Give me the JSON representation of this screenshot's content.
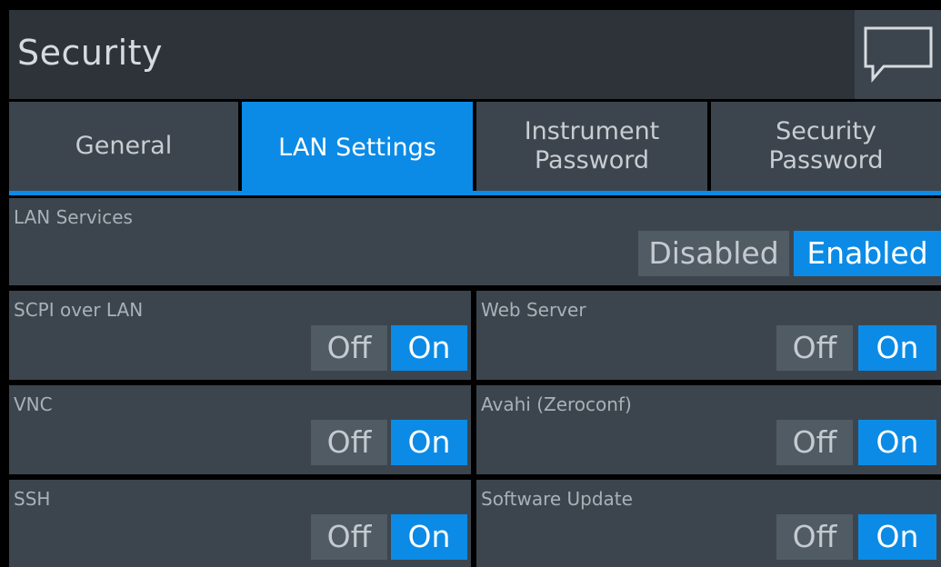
{
  "header": {
    "title": "Security",
    "chat_icon": "speech-bubble-icon"
  },
  "tabs": [
    {
      "label": "General",
      "active": false
    },
    {
      "label": "LAN Settings",
      "active": true
    },
    {
      "label": "Instrument\nPassword",
      "active": false
    },
    {
      "label": "Security\nPassword",
      "active": false
    }
  ],
  "lan_services": {
    "label": "LAN Services",
    "disabled_label": "Disabled",
    "enabled_label": "Enabled",
    "value": "Enabled"
  },
  "settings": {
    "scpi_over_lan": {
      "label": "SCPI over LAN",
      "off": "Off",
      "on": "On",
      "value": "On"
    },
    "web_server": {
      "label": "Web Server",
      "off": "Off",
      "on": "On",
      "value": "On"
    },
    "vnc": {
      "label": "VNC",
      "off": "Off",
      "on": "On",
      "value": "On"
    },
    "avahi": {
      "label": "Avahi (Zeroconf)",
      "off": "Off",
      "on": "On",
      "value": "On"
    },
    "ssh": {
      "label": "SSH",
      "off": "Off",
      "on": "On",
      "value": "On"
    },
    "software_update": {
      "label": "Software Update",
      "off": "Off",
      "on": "On",
      "value": "On"
    }
  },
  "colors": {
    "accent": "#0b8be6",
    "panel": "#3c454d",
    "header": "#2d3338"
  }
}
